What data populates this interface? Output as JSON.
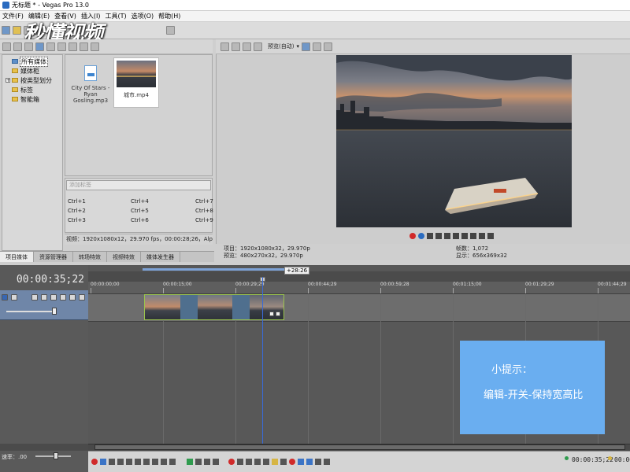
{
  "window": {
    "title": "无标题 * - Vegas Pro 13.0"
  },
  "watermark": "秒懂视频",
  "menu": [
    "文件(F)",
    "编辑(E)",
    "查看(V)",
    "插入(I)",
    "工具(T)",
    "选项(O)",
    "帮助(H)"
  ],
  "media_tree": [
    {
      "label": "所有媒体",
      "selected": true,
      "kind": "media",
      "expander": false
    },
    {
      "label": "媒体柜",
      "selected": false,
      "kind": "folder",
      "expander": false
    },
    {
      "label": "按类型划分",
      "selected": false,
      "kind": "folder",
      "expander": true
    },
    {
      "label": "标签",
      "selected": false,
      "kind": "folder",
      "expander": false
    },
    {
      "label": "智能箱",
      "selected": false,
      "kind": "folder",
      "expander": false
    }
  ],
  "media_files": [
    {
      "name": "City Of Stars - Ryan Gosling.mp3",
      "icon": "mp3-file-icon"
    },
    {
      "name": "城市.mp4",
      "icon": "video-thumbnail"
    }
  ],
  "tag_input_placeholder": "添加标签",
  "shortcuts": {
    "c1": [
      "Ctrl+1",
      "Ctrl+2",
      "Ctrl+3"
    ],
    "c2": [
      "Ctrl+4",
      "Ctrl+5",
      "Ctrl+6"
    ],
    "c3": [
      "Ctrl+7",
      "Ctrl+8",
      "Ctrl+9"
    ]
  },
  "media_info": "视频：1920x1080x12，29.970 fps，00:00:28;26，Alpha = 无，",
  "tabs": [
    "项目媒体",
    "资源管理器",
    "转场特效",
    "视频特效",
    "媒体发生器"
  ],
  "preview": {
    "mode_label": "预览(自动)",
    "project": "项目：1920x1080x32，29.970p",
    "preview": "预览：480x270x32，29.970p",
    "frame": "帧数：1,072",
    "display": "显示：656x369x32"
  },
  "timeline": {
    "timecode": "00:00:35;22",
    "ruler_tip": "+28:26",
    "ticks": [
      "00:00:00;00",
      "00:00:15;00",
      "00:00:29;29",
      "00:00:44;29",
      "00:00:59;28",
      "00:01:15;00",
      "00:01:29;29",
      "00:01:44;29"
    ],
    "rate_label": "速率：.00"
  },
  "hint": {
    "line1": "小提示：",
    "line2": "编辑-开关-保持宽高比"
  },
  "status": {
    "tc1": "00:00:35;22",
    "tc2": "00:00"
  }
}
